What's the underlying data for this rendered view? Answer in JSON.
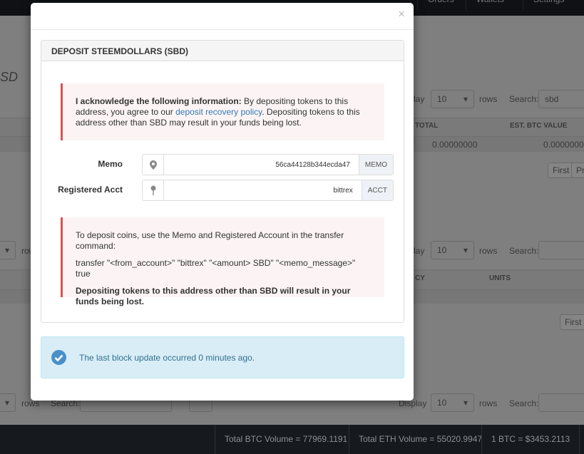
{
  "nav": {
    "items": [
      "Orders",
      "Wallets",
      "Settings"
    ]
  },
  "background": {
    "page_title_fragment": "SD",
    "display_label_fragment": "lay",
    "display_label": "Display",
    "display_value": "10",
    "rows_label": "rows",
    "search_label": "Search:",
    "search_value": "sbd",
    "table1_headers": [
      "TOTAL",
      "EST. BTC VALUE"
    ],
    "table1_values": [
      "0.00000000",
      "0.00000000"
    ],
    "first_label": "First",
    "prev_fragment": "Pr",
    "table2_headers": [
      "CY",
      "UNITS"
    ]
  },
  "footer": {
    "btc_volume": "Total BTC Volume = 77969.1191",
    "eth_volume": "Total ETH Volume = 55020.9947",
    "btc_price": "1 BTC = $3453.2113"
  },
  "modal": {
    "close": "×",
    "panel_title": "DEPOSIT STEEMDOLLARS (SBD)",
    "ack_bold": "I acknowledge the following information:",
    "ack_text1": " By depositing tokens to this address, you agree to our ",
    "ack_link": "deposit recovery policy",
    "ack_text2": ". Depositing tokens to this address other than SBD may result in your funds being lost.",
    "memo_label": "Memo",
    "memo_value": "56ca44128b344ecda47",
    "memo_addon": "MEMO",
    "acct_label": "Registered Acct",
    "acct_value": "bittrex",
    "acct_addon": "ACCT",
    "instr1": "To deposit coins, use the Memo and Registered Account in the transfer command:",
    "instr2": "transfer \"<from_account>\" \"bittrex\" \"<amount> SBD\" \"<memo_message>\" true",
    "instr3": "Depositing tokens to this address other than SBD will result in your funds being lost.",
    "info": "The last block update occurred 0 minutes ago."
  }
}
